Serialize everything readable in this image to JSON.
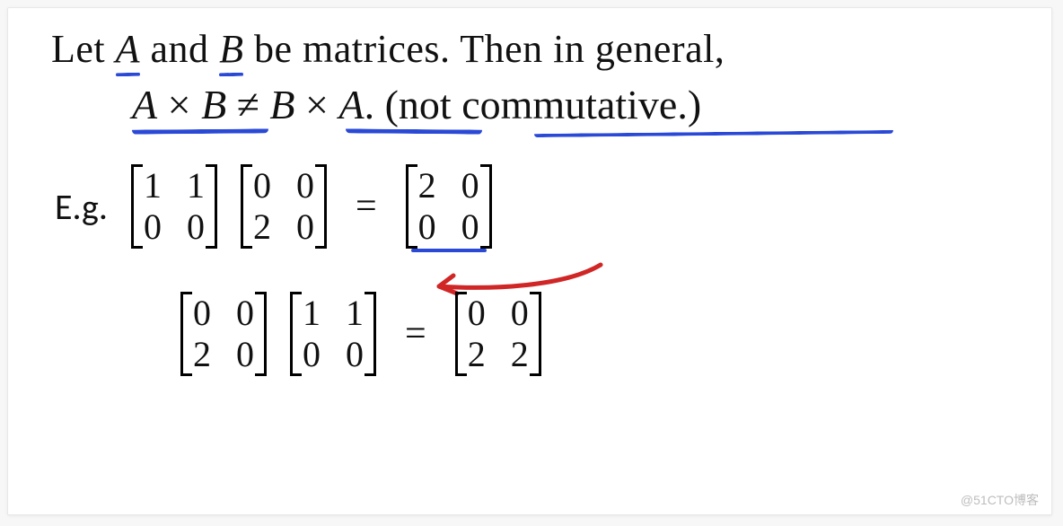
{
  "line1": {
    "t1": "Let ",
    "varA": "A",
    "t2": " and ",
    "varB": "B",
    "t3": " be matrices. Then in general,"
  },
  "line2": {
    "lhs_A": "A",
    "times1": " × ",
    "lhs_B": "B",
    "neq": " ≠ ",
    "rhs_B": "B",
    "times2": " × ",
    "rhs_A": "A",
    "period": ". ",
    "note": "(not commutative.)"
  },
  "eg_label": "E.g.",
  "example1": {
    "M1": [
      "1",
      "1",
      "0",
      "0"
    ],
    "M2": [
      "0",
      "0",
      "2",
      "0"
    ],
    "eq": "=",
    "R": [
      "2",
      "0",
      "0",
      "0"
    ]
  },
  "example2": {
    "M1": [
      "0",
      "0",
      "2",
      "0"
    ],
    "M2": [
      "1",
      "1",
      "0",
      "0"
    ],
    "eq": "=",
    "R": [
      "0",
      "0",
      "2",
      "2"
    ]
  },
  "watermark": "@51CTO博客"
}
